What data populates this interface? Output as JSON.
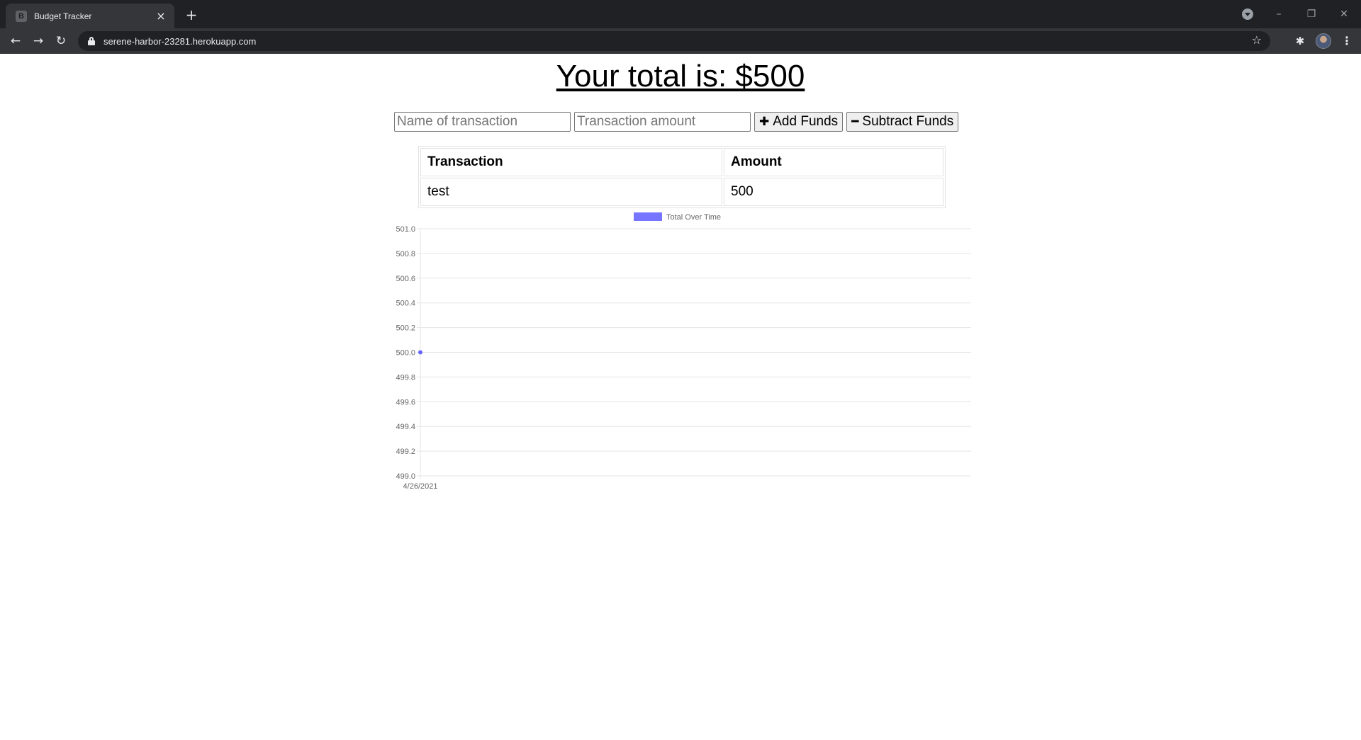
{
  "browser": {
    "tab_title": "Budget Tracker",
    "favicon_letter": "B",
    "url": "serene-harbor-23281.herokuapp.com"
  },
  "page": {
    "total_heading": "Your total is: $500",
    "form": {
      "name_placeholder": "Name of transaction",
      "amount_placeholder": "Transaction amount",
      "add_label": "Add Funds",
      "subtract_label": "Subtract Funds"
    },
    "table": {
      "headers": [
        "Transaction",
        "Amount"
      ],
      "rows": [
        [
          "test",
          "500"
        ]
      ]
    }
  },
  "chart_data": {
    "type": "line",
    "x": [
      "4/26/2021"
    ],
    "series": [
      {
        "name": "Total Over Time",
        "values": [
          500
        ],
        "color": "#6666ff"
      }
    ],
    "y_ticks": [
      "501.0",
      "500.8",
      "500.6",
      "500.4",
      "500.2",
      "500.0",
      "499.8",
      "499.6",
      "499.4",
      "499.2",
      "499.0"
    ],
    "ylim": [
      499.0,
      501.0
    ],
    "grid": true,
    "legend_position": "top"
  }
}
